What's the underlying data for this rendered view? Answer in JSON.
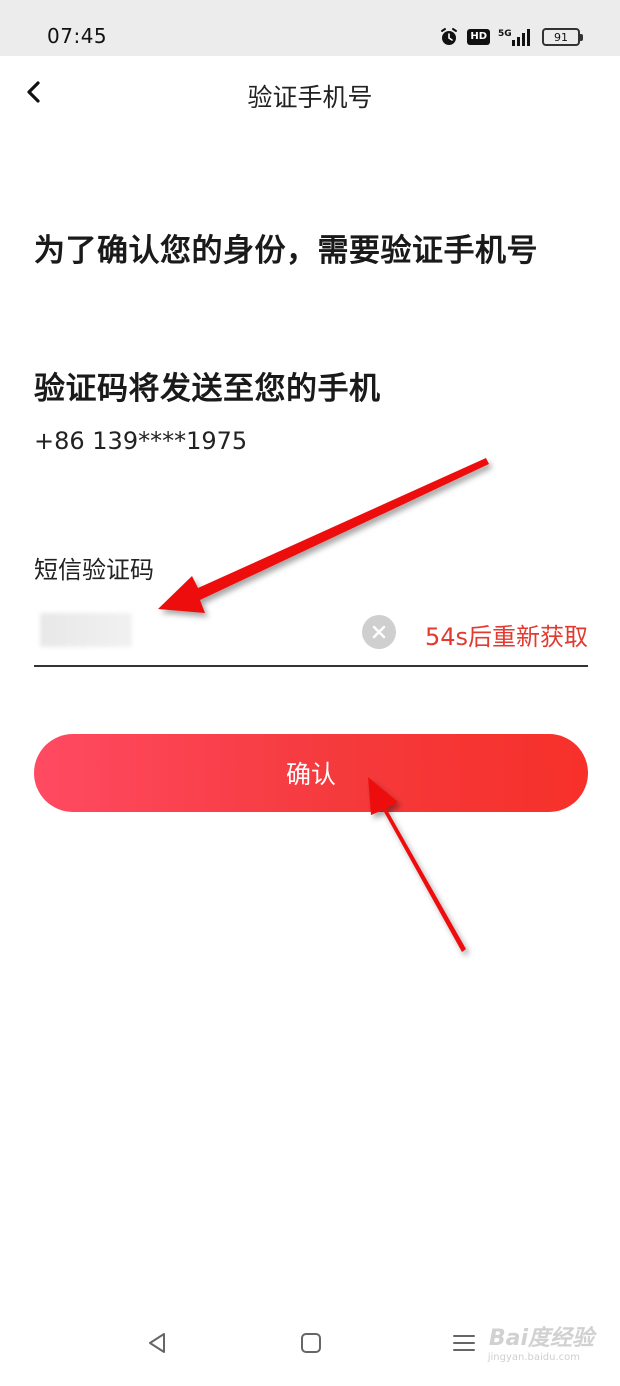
{
  "status_bar": {
    "time": "07:45",
    "icons": [
      "alarm-icon",
      "hd-badge",
      "signal-5g-icon",
      "battery-icon"
    ],
    "hd_label": "HD",
    "network_label": "5G",
    "battery_level": "91"
  },
  "nav": {
    "back_icon": "chevron-left-icon",
    "title": "验证手机号"
  },
  "content": {
    "headline": "为了确认您的身份，需要验证手机号",
    "subheadline": "验证码将发送至您的手机",
    "phone_number": "+86 139****1975",
    "code_label": "短信验证码",
    "code_value": "",
    "resend_countdown": "54s后重新获取",
    "confirm_label": "确认"
  },
  "colors": {
    "accent_red": "#e33a2f",
    "button_gradient_start": "#ff4a62",
    "button_gradient_end": "#f7302a",
    "annotation_arrow": "#ee1111"
  },
  "system_nav": {
    "icons": [
      "triangle-back-icon",
      "square-home-icon",
      "menu-lines-icon"
    ]
  },
  "watermark": {
    "brand": "Bai度经验",
    "url": "jingyan.baidu.com"
  }
}
